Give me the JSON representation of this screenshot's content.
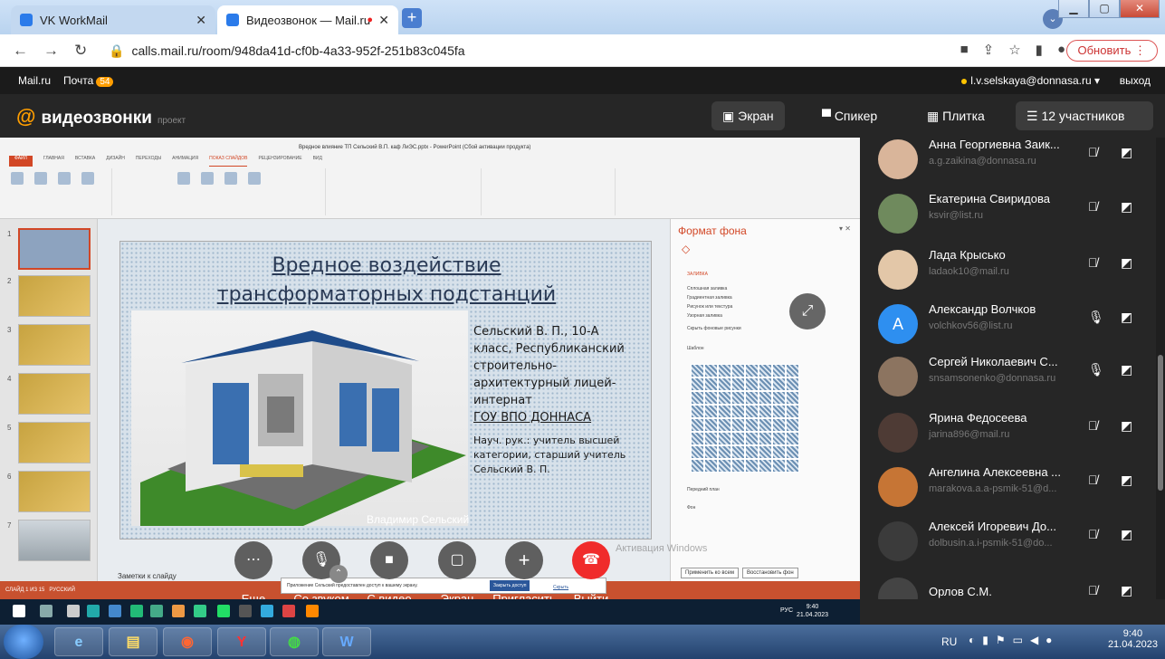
{
  "browser": {
    "tabs": [
      {
        "title": "VK WorkMail",
        "active": false
      },
      {
        "title": "Видеозвонок — Mail.ru",
        "active": true
      }
    ],
    "url": "calls.mail.ru/room/948da41d-cf0b-4a33-952f-251b83c045fa",
    "update_label": "Обновить"
  },
  "mail": {
    "brand": "Mail.ru",
    "pochta": "Почта",
    "pochta_count": "54",
    "user": "l.v.selskaya@donnasa.ru",
    "logout": "выход"
  },
  "call": {
    "logo": "видеозвонки",
    "logo_sub": "проект",
    "views": {
      "screen": "Экран",
      "speaker": "Спикер",
      "tile": "Плитка"
    },
    "participants_label": "12 участников",
    "controls": {
      "more": "Еще",
      "sound": "Со звуком",
      "video": "С видео",
      "screen": "Экран",
      "invite": "Пригласить",
      "leave": "Выйти"
    }
  },
  "shared_screen": {
    "ppt_title": "Вредное влияние ТП Сельский В.П. каф ЛиЭС.pptx - PowerPoint (Сбой активации продукта)",
    "tabs": [
      "ФАЙЛ",
      "ГЛАВНАЯ",
      "ВСТАВКА",
      "ДИЗАЙН",
      "ПЕРЕХОДЫ",
      "АНИМАЦИЯ",
      "ПОКАЗ СЛАЙДОВ",
      "РЕЦЕНЗИРОВАНИЕ",
      "ВИД"
    ],
    "slide_title_1": "Вредное воздействие",
    "slide_title_2": "трансформаторных подстанций",
    "slide_text": [
      "Сельский В. П., 10-А",
      "класс, Республиканский",
      "строительно-",
      "архитектурный лицей-",
      "интернат",
      " ГОУ ВПО ДОННАСА"
    ],
    "slide_sup": [
      "Науч. рук.: учитель высшей",
      "категории, старший учитель",
      "Сельский В. П."
    ],
    "presenter": "Владимир Сельский",
    "notes": "Заметки к слайду",
    "format_pane": "Формат фона",
    "fill_label": "ЗАЛИВКА",
    "fill_options": [
      "Сплошная заливка",
      "Градиентная заливка",
      "Рисунок или текстура",
      "Узорная заливка",
      "Скрыть фоновые рисунки"
    ],
    "pattern_label": "Шаблон",
    "fg_label": "Передний план",
    "bg_label": "Фон",
    "apply_all": "Применить ко всем",
    "restore_bg": "Восстановить фон",
    "access_text": "Приложение Сельский предоставлен доступ к вашему экрану.",
    "access_btn": "Закрыть доступ",
    "access_hide": "Скрыть",
    "windows_activation": "Активация Windows",
    "status": "СЛАЙД 1 ИЗ 15",
    "status_lang": "РУССКИЙ",
    "remote_lang": "РУС",
    "remote_time": "9:40",
    "remote_date": "21.04.2023"
  },
  "participants": [
    {
      "name": "Анна Георгиевна Заик...",
      "email": "a.g.zaikina@donnasa.ru",
      "color": "#d9b59a",
      "muted": true
    },
    {
      "name": "Екатерина Свиридова",
      "email": "ksvir@list.ru",
      "color": "#6f8a5d",
      "muted": true
    },
    {
      "name": "Лада Крысько",
      "email": "ladaok10@mail.ru",
      "color": "#e3c7a8",
      "muted": true
    },
    {
      "name": "Александр Волчков",
      "email": "volchkov56@list.ru",
      "color": "#2e8ff0",
      "initial": "A",
      "muted": false
    },
    {
      "name": "Сергей Николаевич С...",
      "email": "snsamsonenko@donnasa.ru",
      "color": "#8c7460",
      "muted": false
    },
    {
      "name": "Ярина Федосеева",
      "email": "jarina896@mail.ru",
      "color": "#4e3b35",
      "muted": true
    },
    {
      "name": "Ангелина Алексеевна ...",
      "email": "marakova.a.a-psmik-51@d...",
      "color": "#c67535",
      "muted": true
    },
    {
      "name": "Алексей Игоревич До...",
      "email": "dolbusin.a.i-psmik-51@do...",
      "color": "#3b3b3b",
      "muted": true
    },
    {
      "name": "Орлов С.М.",
      "email": "",
      "color": "#444444",
      "muted": true
    }
  ],
  "taskbar": {
    "lang": "RU",
    "time": "9:40",
    "date": "21.04.2023"
  },
  "colors": {
    "accent": "#ff9e00",
    "leave": "#f02b2b",
    "ppt": "#d24726"
  }
}
